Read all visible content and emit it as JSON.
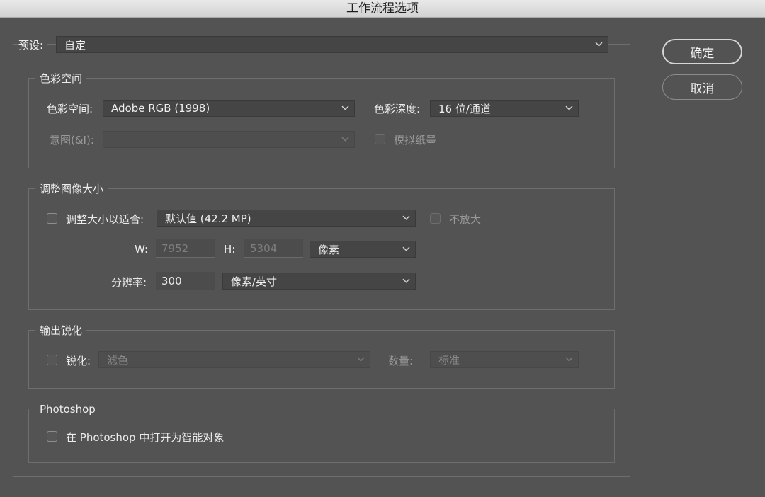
{
  "window": {
    "title": "工作流程选项"
  },
  "preset": {
    "label": "预设:",
    "value": "自定"
  },
  "color_space": {
    "title": "色彩空间",
    "space_label": "色彩空间:",
    "space_value": "Adobe RGB (1998)",
    "depth_label": "色彩深度:",
    "depth_value": "16 位/通道",
    "intent_label": "意图(&I):",
    "intent_value": "",
    "simulate_label": "模拟纸墨"
  },
  "resize": {
    "title": "调整图像大小",
    "fit_label": "调整大小以适合:",
    "fit_value": "默认值 (42.2 MP)",
    "no_enlarge_label": "不放大",
    "w_label": "W:",
    "w_value": "7952",
    "h_label": "H:",
    "h_value": "5304",
    "unit_value": "像素",
    "res_label": "分辨率:",
    "res_value": "300",
    "res_unit_value": "像素/英寸"
  },
  "sharpen": {
    "title": "输出锐化",
    "sharpen_label": "锐化:",
    "sharpen_value": "滤色",
    "amount_label": "数量:",
    "amount_value": "标准"
  },
  "photoshop": {
    "title": "Photoshop",
    "smart_object_label": "在 Photoshop 中打开为智能对象"
  },
  "buttons": {
    "ok": "确定",
    "cancel": "取消"
  },
  "icons": {
    "dropdown": "chevron-down-icon"
  },
  "colors": {
    "background": "#535353",
    "border": "#6e6e6e",
    "control": "#454545"
  }
}
